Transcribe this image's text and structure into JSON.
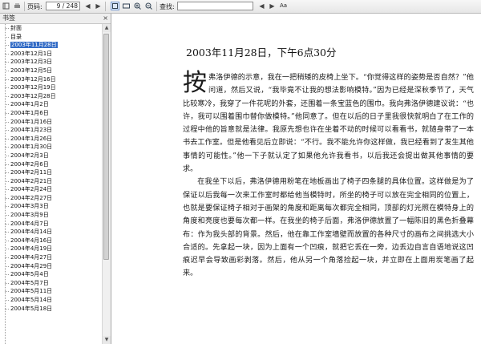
{
  "toolbar": {
    "page_label": "页码:",
    "page_value": "9 / 248",
    "find_label": "查找:",
    "find_value": "",
    "case_label": "Aa"
  },
  "sidebar": {
    "title": "书签",
    "close": "×",
    "items": [
      {
        "label": "封面",
        "selected": false
      },
      {
        "label": "目录",
        "selected": false
      },
      {
        "label": "2003年11月28日",
        "selected": true
      },
      {
        "label": "2003年12月1日",
        "selected": false
      },
      {
        "label": "2003年12月3日",
        "selected": false
      },
      {
        "label": "2003年12月5日",
        "selected": false
      },
      {
        "label": "2003年12月16日",
        "selected": false
      },
      {
        "label": "2003年12月19日",
        "selected": false
      },
      {
        "label": "2003年12月28日",
        "selected": false
      },
      {
        "label": "2004年1月2日",
        "selected": false
      },
      {
        "label": "2004年1月6日",
        "selected": false
      },
      {
        "label": "2004年1月16日",
        "selected": false
      },
      {
        "label": "2004年1月23日",
        "selected": false
      },
      {
        "label": "2004年1月26日",
        "selected": false
      },
      {
        "label": "2004年1月30日",
        "selected": false
      },
      {
        "label": "2004年2月3日",
        "selected": false
      },
      {
        "label": "2004年2月6日",
        "selected": false
      },
      {
        "label": "2004年2月11日",
        "selected": false
      },
      {
        "label": "2004年2月21日",
        "selected": false
      },
      {
        "label": "2004年2月24日",
        "selected": false
      },
      {
        "label": "2004年2月27日",
        "selected": false
      },
      {
        "label": "2004年3月3日",
        "selected": false
      },
      {
        "label": "2004年3月9日",
        "selected": false
      },
      {
        "label": "2004年4月7日",
        "selected": false
      },
      {
        "label": "2004年4月14日",
        "selected": false
      },
      {
        "label": "2004年4月16日",
        "selected": false
      },
      {
        "label": "2004年4月19日",
        "selected": false
      },
      {
        "label": "2004年4月27日",
        "selected": false
      },
      {
        "label": "2004年4月29日",
        "selected": false
      },
      {
        "label": "2004年5月4日",
        "selected": false
      },
      {
        "label": "2004年5月7日",
        "selected": false
      },
      {
        "label": "2004年5月11日",
        "selected": false
      },
      {
        "label": "2004年5月14日",
        "selected": false
      },
      {
        "label": "2004年5月18日",
        "selected": false
      }
    ]
  },
  "document": {
    "title": "2003年11月28日，下午6点30分",
    "dropcap": "按",
    "paragraphs": [
      "弗洛伊德的示意，我在一把稍矮的皮椅上坐下。“你觉得这样的姿势是否自然？”他问道，然后又说，“我毕竟不让我的想法影响模特。”因为已经是深秋季节了，天气比较寒冷，我穿了一件花呢的外套，还围着一条宝蓝色的围巾。我向弗洛伊德建议说：“也许，我可以围着围巾替你做模特。”他同意了。但在以后的日子里我很快就明白了在工作的过程中他的旨意就是法律。我原先想也许在坐着不动的时候可以看看书，就随身带了一本书去工作室。但是他看见后立即说：“不行。我不能允许你这样做，我已经看到了发生其他事情的可能性。”他一下子就认定了如果他允许我看书，以后我还会提出做其他事情的要求。",
      "在我坐下以后，弗洛伊德用粉笔在地板画出了椅子四条腿的具体位置。这样做是为了保证以后我每一次来工作室时都给他当模特时，所坐的椅子可以放在完全相同的位置上，也就是要保证椅子相对于画架的角度和距离每次都完全相同，顶部的灯光照在模特身上的角度和亮度也要每次都一样。在我坐的椅子后面，弗洛伊德放置了一幅陈旧的黑色折叠幕布：作为我头部的背景。然后，他在靠工作室墙壁而放置的各种尺寸的画布之间挑选大小合适的。先拿起一块，因为上面有一个凹痕，就把它丢在一旁，边丢边自言自语地说这凹痕迟早会导致画彩剥落。然后，他从另一个角落捡起一块，并立即在上面用炭笔画了起来。"
    ]
  }
}
